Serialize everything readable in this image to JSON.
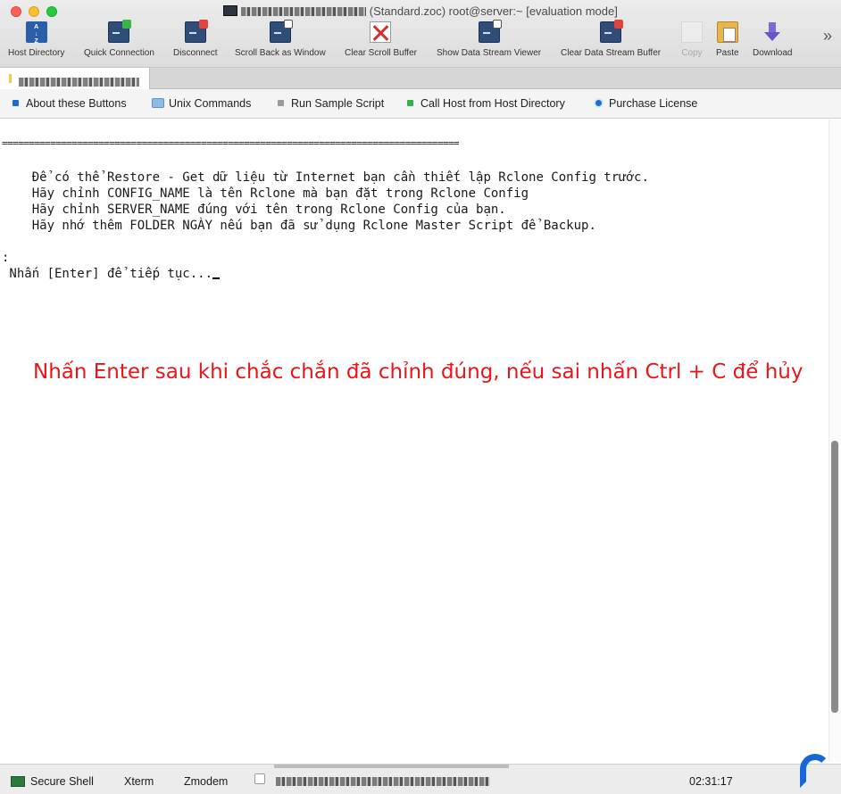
{
  "window": {
    "title_suffix": "(Standard.zoc) root@server:~ [evaluation mode]"
  },
  "toolbar": {
    "items": [
      {
        "label": "Host Directory",
        "icon": "host-directory-icon"
      },
      {
        "label": "Quick Connection",
        "icon": "quick-connection-icon"
      },
      {
        "label": "Disconnect",
        "icon": "disconnect-icon"
      },
      {
        "label": "Scroll Back as Window",
        "icon": "scroll-back-icon"
      },
      {
        "label": "Clear Scroll Buffer",
        "icon": "clear-scroll-buffer-icon"
      },
      {
        "label": "Show Data Stream Viewer",
        "icon": "data-stream-viewer-icon"
      },
      {
        "label": "Clear Data Stream Buffer",
        "icon": "clear-data-stream-icon"
      },
      {
        "label": "Copy",
        "icon": "copy-icon"
      },
      {
        "label": "Paste",
        "icon": "paste-icon"
      },
      {
        "label": "Download",
        "icon": "download-icon"
      }
    ],
    "overflow": "»"
  },
  "buttonbar": {
    "about": "About these Buttons",
    "unix": "Unix Commands",
    "sample": "Run Sample Script",
    "call_host": "Call Host from Host Directory",
    "purchase": "Purchase License"
  },
  "terminal": {
    "separator": "=====================================================================================",
    "line1": "    Để có thể Restore - Get dữ liệu từ Internet bạn cần thiết lập Rclone Config trước.",
    "line2": "    Hãy chỉnh CONFIG_NAME là tên Rclone mà bạn đặt trong Rclone Config",
    "line3": "    Hãy chỉnh SERVER_NAME đúng với tên trong Rclone Config của bạn.",
    "line4": "    Hãy nhớ thêm FOLDER NGÀY nếu bạn đã sử dụng Rclone Master Script để Backup.",
    "colon": ":",
    "prompt": " Nhấn [Enter] để tiếp tục..."
  },
  "annotation": "Nhấn Enter sau khi chắc chắn đã chỉnh đúng, nếu sai nhấn Ctrl + C để hủy",
  "statusbar": {
    "secure_shell": "Secure Shell",
    "xterm": "Xterm",
    "zmodem": "Zmodem",
    "clock": "02:31:17"
  },
  "colors": {
    "annotation": "#e8161a",
    "accent": "#1468d8"
  }
}
